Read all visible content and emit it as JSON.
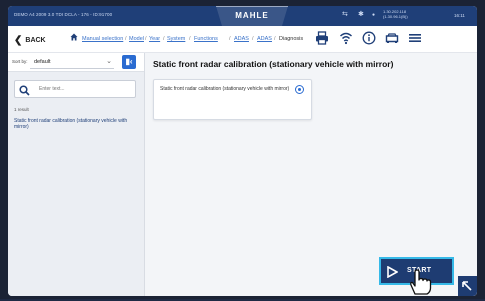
{
  "topbar": {
    "vehicle_info": "DEMO A4 2009 3.0 TDI DCLA - 176 - ID:91700",
    "brand": "MAHLE",
    "ip_line1": "1.30.202.118",
    "ip_line2": "(1.30.96.1(B))",
    "time": "16:11"
  },
  "nav": {
    "back_label": "BACK",
    "breadcrumbs": [
      "Manual selection",
      "Model",
      "Year",
      "System",
      "Functions",
      "ADAS",
      "ADAS"
    ],
    "diagnosis_label": "Diagnosis"
  },
  "sidebar": {
    "sort_label": "Sort by:",
    "sort_value": "default",
    "search_placeholder": "Enter text...",
    "result_count": "1 result",
    "result_item": "Static front radar calibration (stationary vehicle with mirror)"
  },
  "main": {
    "title": "Static front radar calibration (stationary vehicle with mirror)",
    "card_text": "Static front radar calibration (stationary vehicle with mirror)",
    "start_label": "START"
  },
  "colors": {
    "topbar": "#1f3f78",
    "accent": "#2a6bd1",
    "start_border": "#35b9e8"
  },
  "icons": [
    "home-icon",
    "printer-icon",
    "wifi-icon",
    "info-icon",
    "car-icon",
    "menu-icon",
    "search-icon",
    "play-icon",
    "hand-pointer-icon"
  ]
}
